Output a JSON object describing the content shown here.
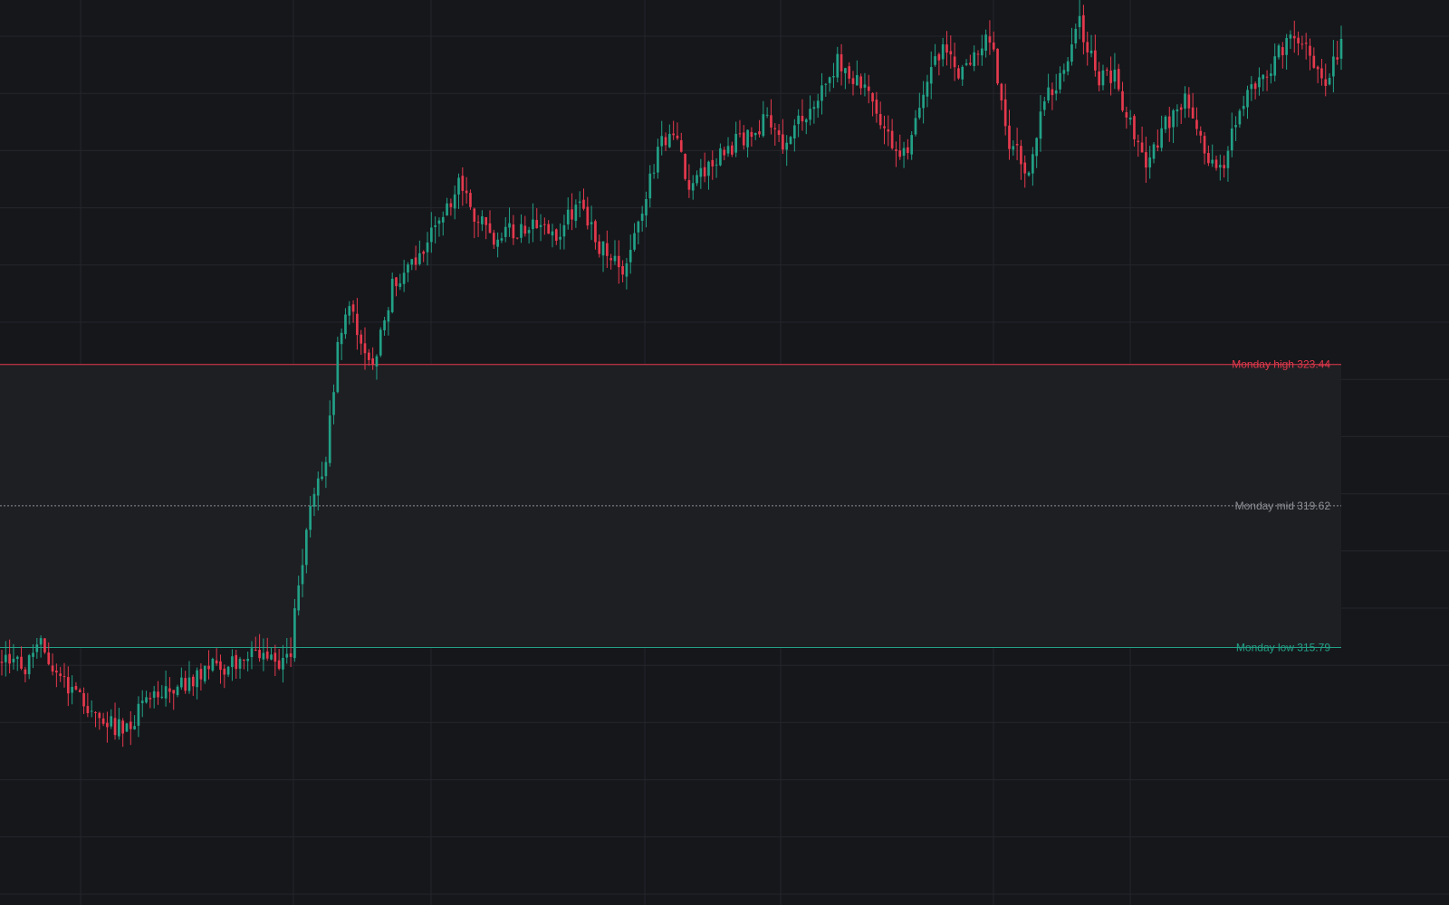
{
  "colors": {
    "background": "#16171b",
    "grid": "#24262c",
    "up": "#22a187",
    "down": "#e5394d",
    "mid": "#8d8f96",
    "range_fill": "#1e1f23"
  },
  "chart_data": {
    "type": "candlestick",
    "title": "",
    "xlabel": "",
    "ylabel": "",
    "ylim": [
      308.83,
      333.29
    ],
    "grid": true,
    "levels": [
      {
        "name": "Monday high",
        "value": 323.44,
        "label": "Monday high 323.44",
        "color": "#e5394d",
        "style": "solid"
      },
      {
        "name": "Monday mid",
        "value": 319.62,
        "label": "Monday mid 319.62",
        "color": "#8d8f96",
        "style": "dotted"
      },
      {
        "name": "Monday low",
        "value": 315.79,
        "label": "Monday low 315.79",
        "color": "#22a187",
        "style": "solid"
      }
    ],
    "monday_range": {
      "high": 323.44,
      "low": 315.79
    },
    "anchors": [
      [
        0,
        315.4
      ],
      [
        6,
        315.2
      ],
      [
        10,
        315.8
      ],
      [
        14,
        315.1
      ],
      [
        19,
        314.6
      ],
      [
        24,
        313.9
      ],
      [
        29,
        313.6
      ],
      [
        34,
        313.9
      ],
      [
        40,
        314.6
      ],
      [
        47,
        314.8
      ],
      [
        52,
        315.2
      ],
      [
        58,
        315.3
      ],
      [
        64,
        315.6
      ],
      [
        69,
        315.5
      ],
      [
        74,
        315.4
      ],
      [
        75,
        316.8
      ],
      [
        79,
        319.7
      ],
      [
        83,
        320.9
      ],
      [
        86,
        323.8
      ],
      [
        89,
        325.1
      ],
      [
        93,
        323.5
      ],
      [
        96,
        323.8
      ],
      [
        100,
        325.6
      ],
      [
        105,
        326.2
      ],
      [
        110,
        327.0
      ],
      [
        114,
        327.7
      ],
      [
        117,
        328.3
      ],
      [
        121,
        327.5
      ],
      [
        126,
        326.8
      ],
      [
        131,
        327.1
      ],
      [
        137,
        327.2
      ],
      [
        143,
        327.0
      ],
      [
        148,
        327.9
      ],
      [
        153,
        326.6
      ],
      [
        156,
        326.3
      ],
      [
        160,
        326.0
      ],
      [
        164,
        327.6
      ],
      [
        169,
        329.5
      ],
      [
        172,
        329.8
      ],
      [
        176,
        328.3
      ],
      [
        181,
        328.9
      ],
      [
        186,
        329.3
      ],
      [
        191,
        329.7
      ],
      [
        196,
        330.0
      ],
      [
        200,
        329.3
      ],
      [
        206,
        330.2
      ],
      [
        210,
        330.9
      ],
      [
        214,
        331.6
      ],
      [
        219,
        331.2
      ],
      [
        224,
        330.4
      ],
      [
        228,
        329.2
      ],
      [
        232,
        329.4
      ],
      [
        236,
        330.6
      ],
      [
        241,
        332.2
      ],
      [
        245,
        331.1
      ],
      [
        248,
        331.7
      ],
      [
        253,
        332.4
      ],
      [
        258,
        329.5
      ],
      [
        263,
        328.6
      ],
      [
        267,
        330.8
      ],
      [
        271,
        331.1
      ],
      [
        276,
        332.6
      ],
      [
        281,
        331.1
      ],
      [
        285,
        331.2
      ],
      [
        290,
        329.5
      ],
      [
        293,
        328.8
      ],
      [
        299,
        330.1
      ],
      [
        304,
        330.6
      ],
      [
        308,
        329.2
      ],
      [
        312,
        328.6
      ],
      [
        316,
        330.1
      ],
      [
        320,
        330.8
      ],
      [
        323,
        331.1
      ],
      [
        327,
        332.0
      ],
      [
        332,
        332.3
      ],
      [
        336,
        331.5
      ],
      [
        339,
        331.2
      ],
      [
        343,
        332.0
      ]
    ],
    "candle_count": 344,
    "seed": 20240617
  }
}
